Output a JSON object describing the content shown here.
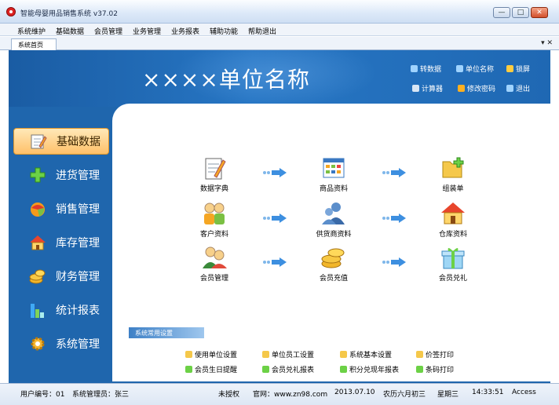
{
  "window": {
    "title": "智能母婴用品销售系统 v37.02",
    "minimize_label": "—",
    "maximize_label": "□",
    "close_label": "✕"
  },
  "menu": [
    "系统维护",
    "基础数据",
    "会员管理",
    "业务管理",
    "业务报表",
    "辅助功能",
    "帮助退出"
  ],
  "tab": {
    "label": "系统首页",
    "close_label": "▾ ✕"
  },
  "header": {
    "company_name": "××××单位名称",
    "tools": [
      {
        "label": "转数据",
        "icon": "database-icon",
        "color": "#9fd3ff"
      },
      {
        "label": "单位名称",
        "icon": "building-icon",
        "color": "#9fd3ff"
      },
      {
        "label": "锁屏",
        "icon": "lock-icon",
        "color": "#ffcc40"
      },
      {
        "label": "计算器",
        "icon": "calculator-icon",
        "color": "#d8e6f5"
      },
      {
        "label": "修改密码",
        "icon": "key-icon",
        "color": "#ffb020"
      },
      {
        "label": "退出",
        "icon": "exit-icon",
        "color": "#9fd3ff"
      }
    ]
  },
  "nav": [
    {
      "label": "基础数据",
      "icon": "notepad-pencil-icon",
      "active": true
    },
    {
      "label": "进货管理",
      "icon": "green-plus-icon",
      "active": false
    },
    {
      "label": "销售管理",
      "icon": "shopping-ball-icon",
      "active": false
    },
    {
      "label": "库存管理",
      "icon": "house-icon",
      "active": false
    },
    {
      "label": "财务管理",
      "icon": "coins-icon",
      "active": false
    },
    {
      "label": "统计报表",
      "icon": "bar-chart-icon",
      "active": false
    },
    {
      "label": "系统管理",
      "icon": "gear-icon",
      "active": false
    }
  ],
  "functions": [
    {
      "label": "数据字典",
      "icon": "notepad-pencil-icon"
    },
    {
      "label": "商品资料",
      "icon": "product-table-icon"
    },
    {
      "label": "组装单",
      "icon": "folder-add-icon"
    },
    {
      "label": "客户资料",
      "icon": "customers-icon"
    },
    {
      "label": "供货商资料",
      "icon": "suppliers-icon"
    },
    {
      "label": "仓库资料",
      "icon": "warehouse-icon"
    },
    {
      "label": "会员管理",
      "icon": "members-icon"
    },
    {
      "label": "会员充值",
      "icon": "coins-icon"
    },
    {
      "label": "会员兑礼",
      "icon": "gift-icon"
    }
  ],
  "common": {
    "title": "系统常用设置",
    "links": [
      "使用单位设置",
      "单位员工设置",
      "系统基本设置",
      "价签打印",
      "会员生日提醒",
      "会员兑礼报表",
      "积分兑现年报表",
      "条码打印"
    ]
  },
  "status": {
    "user": "用户编号：01",
    "operator": "系统管理员：张三",
    "version": "未授权",
    "website": "官网：www.zn98.com",
    "date": "2013.07.10",
    "lunar": "农历六月初三",
    "weekday": "星期三",
    "time": "14:33:51",
    "db": "Access"
  },
  "colors": {
    "panel_blue": "#1f66ad",
    "active_nav": "#ffc069"
  }
}
